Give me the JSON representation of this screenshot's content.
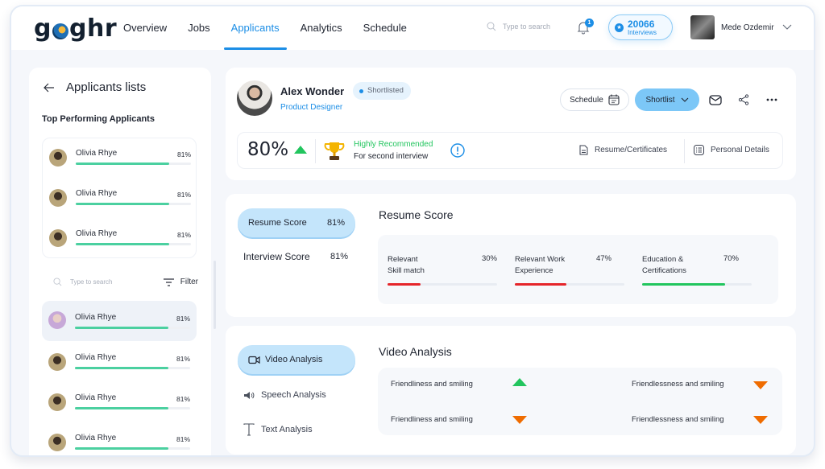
{
  "brand": {
    "logo_pre": "g",
    "logo_post": "ghr",
    "accent": "#1c8ee6"
  },
  "nav": {
    "items": [
      {
        "label": "Overview",
        "active": false
      },
      {
        "label": "Jobs",
        "active": false
      },
      {
        "label": "Applicants",
        "active": true
      },
      {
        "label": "Analytics",
        "active": false
      },
      {
        "label": "Schedule",
        "active": false
      }
    ],
    "search_placeholder": "Type to search",
    "notifications_count": "1",
    "interviews": {
      "count": "20066",
      "label": "Interviews"
    },
    "user_name": "Mede Ozdemir"
  },
  "sidebar": {
    "title": "Applicants lists",
    "top_title": "Top Performing Applicants",
    "top_applicants": [
      {
        "name": "Olivia Rhye",
        "score": "81%",
        "progress": 0.81
      },
      {
        "name": "Olivia Rhye",
        "score": "81%",
        "progress": 0.81
      },
      {
        "name": "Olivia Rhye",
        "score": "81%",
        "progress": 0.81
      }
    ],
    "search_placeholder": "Type to search",
    "filter_label": "Filter",
    "applicants": [
      {
        "name": "Olivia Rhye",
        "score": "81%",
        "progress": 0.81,
        "selected": true
      },
      {
        "name": "Olivia Rhye",
        "score": "81%",
        "progress": 0.81,
        "selected": false
      },
      {
        "name": "Olivia Rhye",
        "score": "81%",
        "progress": 0.81,
        "selected": false
      },
      {
        "name": "Olivia Rhye",
        "score": "81%",
        "progress": 0.81,
        "selected": false
      }
    ]
  },
  "profile": {
    "name": "Alex Wonder",
    "role": "Product Designer",
    "status": "Shortlisted",
    "schedule_label": "Schedule",
    "shortlist_label": "Shortlist",
    "overall_score": "80%",
    "recommendation": "Highly Recommended",
    "recommendation_sub": "For second interview",
    "resume_link": "Resume/Certificates",
    "details_link": "Personal Details"
  },
  "resume_section": {
    "tabs": [
      {
        "label": "Resume Score",
        "value": "81%",
        "active": true
      },
      {
        "label": "Interview Score",
        "value": "81%",
        "active": false
      }
    ],
    "title": "Resume Score",
    "metrics": [
      {
        "label_line1": "Relevant",
        "label_line2": "Skill match",
        "value": "30%",
        "progress": 0.3,
        "color": "#e5252a"
      },
      {
        "label_line1": "Relevant Work",
        "label_line2": "Experience",
        "value": "47%",
        "progress": 0.47,
        "color": "#e5252a"
      },
      {
        "label_line1": "Education &",
        "label_line2": "Certifications",
        "value": "70%",
        "progress": 0.76,
        "color": "#22c55e"
      }
    ]
  },
  "video_section": {
    "tabs": [
      {
        "label": "Video Analysis",
        "active": true
      },
      {
        "label": "Speech Analysis",
        "active": false
      },
      {
        "label": "Text Analysis",
        "active": false
      }
    ],
    "title": "Video Analysis",
    "items": [
      {
        "label": "Friendliness and smiling",
        "trend": "up"
      },
      {
        "label": "Friendlessness and smiling",
        "trend": "down"
      },
      {
        "label": "Friendliness and smiling",
        "trend": "down"
      },
      {
        "label": "Friendlessness and smiling",
        "trend": "down"
      }
    ]
  }
}
